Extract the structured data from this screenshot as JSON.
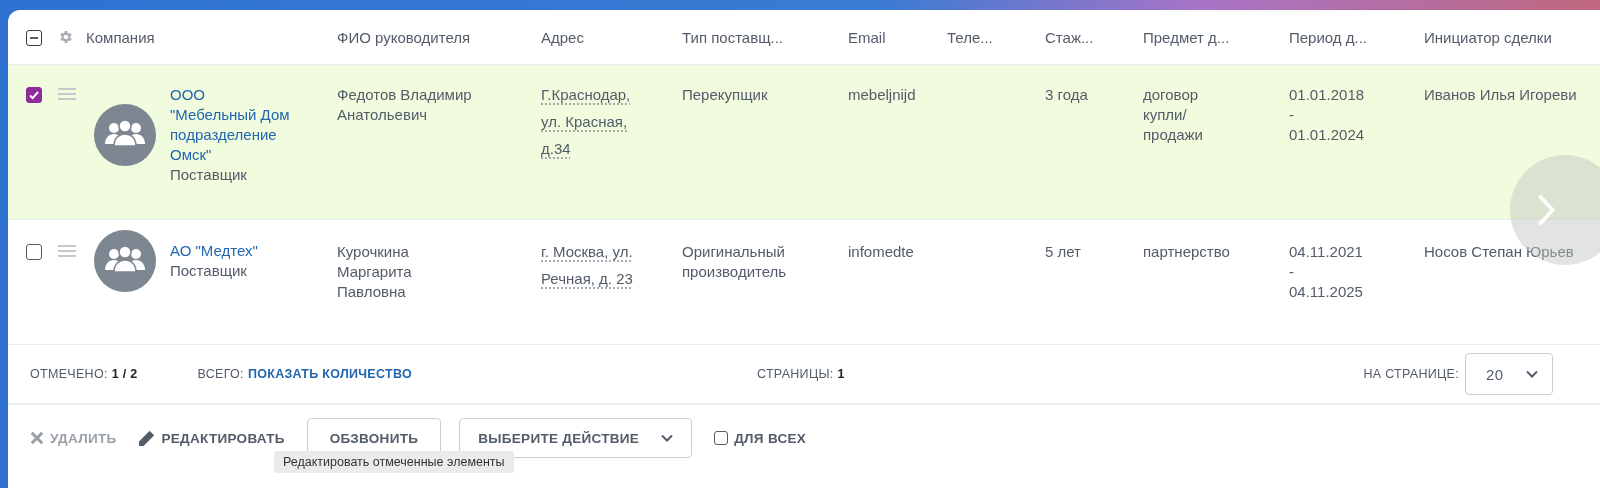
{
  "header": {
    "select_all": {
      "partial": true
    },
    "columns": [
      "Компания",
      "ФИО руководителя",
      "Адрес",
      "Тип поставщ...",
      "Email",
      "Теле...",
      "Стаж...",
      "Предмет д...",
      "Период д...",
      "Инициатор сделки"
    ]
  },
  "rows": [
    {
      "selected": true,
      "company": "ООО \"Мебельный Дом подразделение Омск\"",
      "company_type": "Поставщик",
      "director": "Федотов Владимир Анатольевич",
      "address": "Г.Краснодар, ул. Красная, д.34",
      "supplier_type": "Перекупщик",
      "email": "mebeljnijd",
      "experience": "3 года",
      "subject": "договор купли/ продажи",
      "period": "01.01.2018 - 01.01.2024",
      "initiator": "Иванов Илья Игореви"
    },
    {
      "selected": false,
      "company": "АО \"Медтех\"",
      "company_type": "Поставщик",
      "director": "Курочкина Маргарита Павловна",
      "address": "г. Москва, ул. Речная, д. 23",
      "supplier_type": "Оригинальный производитель",
      "email": "infomedte",
      "experience": "5 лет",
      "subject": "партнерство",
      "period": "04.11.2021 - 04.11.2025",
      "initiator": "Носов Степан Юрьев"
    }
  ],
  "summary": {
    "checked_label": "ОТМЕЧЕНО:",
    "checked_value": "1 / 2",
    "total_label": "ВСЕГО:",
    "total_link": "ПОКАЗАТЬ КОЛИЧЕСТВО",
    "pages_label": "СТРАНИЦЫ:",
    "pages_value": "1",
    "per_page_label": "НА СТРАНИЦЕ:",
    "per_page_value": "20"
  },
  "actions": [
    {
      "kind": "delete",
      "label": "УДАЛИТЬ",
      "disabled": true
    },
    {
      "kind": "edit",
      "label": "РЕДАКТИРОВАТЬ",
      "disabled": false
    },
    {
      "kind": "button",
      "label": "ОБЗВОНИТЬ"
    },
    {
      "kind": "dropdown",
      "label": "ВЫБЕРИТЕ ДЕЙСТВИЕ"
    },
    {
      "kind": "checkbox",
      "label": "ДЛЯ ВСЕХ",
      "checked": false
    }
  ],
  "tooltip": "Редактировать отмеченные элементы"
}
